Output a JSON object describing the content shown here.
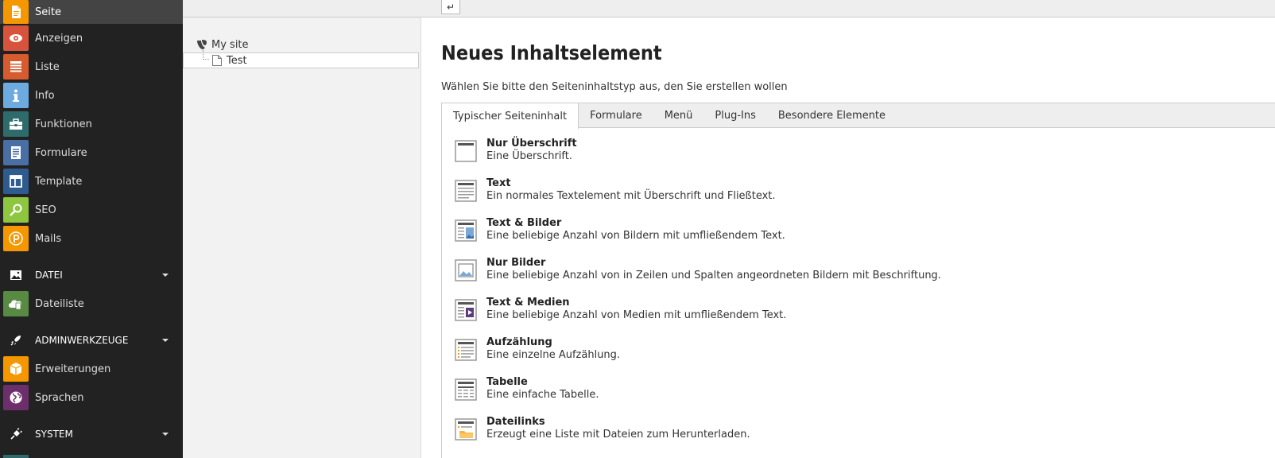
{
  "modules": [
    {
      "label": "Seite",
      "icon": "page-icon",
      "color": "#f49700",
      "active": true
    },
    {
      "label": "Anzeigen",
      "icon": "eye-icon",
      "color": "#d8533b"
    },
    {
      "label": "Liste",
      "icon": "list-icon",
      "color": "#d65b2f"
    },
    {
      "label": "Info",
      "icon": "info-icon",
      "color": "#6daae0"
    },
    {
      "label": "Funktionen",
      "icon": "toolbox-icon",
      "color": "#2e6c6c"
    },
    {
      "label": "Formulare",
      "icon": "form-icon",
      "color": "#4a6fa5"
    },
    {
      "label": "Template",
      "icon": "template-icon",
      "color": "#2f5c8e"
    },
    {
      "label": "SEO",
      "icon": "magnifier-icon",
      "color": "#8ec63f"
    },
    {
      "label": "Mails",
      "icon": "mail-p-icon",
      "color": "#f49700"
    }
  ],
  "groups": [
    {
      "label": "DATEI",
      "icon": "image-icon",
      "items": [
        {
          "label": "Dateiliste",
          "icon": "cloud-file-icon",
          "color": "#588a44"
        }
      ]
    },
    {
      "label": "ADMINWERKZEUGE",
      "icon": "rocket-icon",
      "items": [
        {
          "label": "Erweiterungen",
          "icon": "box-icon",
          "color": "#f49700"
        },
        {
          "label": "Sprachen",
          "icon": "globe-icon",
          "color": "#6c2f6c"
        }
      ]
    },
    {
      "label": "SYSTEM",
      "icon": "plug-icon",
      "items": []
    }
  ],
  "tree": {
    "root": "My site",
    "child": "Test"
  },
  "header": {
    "back_symbol": "↵"
  },
  "content": {
    "title": "Neues Inhaltselement",
    "description": "Wählen Sie bitte den Seiteninhaltstyp aus, den Sie erstellen wollen",
    "tabs": [
      "Typischer Seiteninhalt",
      "Formulare",
      "Menü",
      "Plug-Ins",
      "Besondere Elemente"
    ],
    "elements": [
      {
        "title": "Nur Überschrift",
        "desc": "Eine Überschrift.",
        "icon": "header-only-icon"
      },
      {
        "title": "Text",
        "desc": "Ein normales Textelement mit Überschrift und Fließtext.",
        "icon": "text-icon"
      },
      {
        "title": "Text & Bilder",
        "desc": "Eine beliebige Anzahl von Bildern mit umfließendem Text.",
        "icon": "text-images-icon"
      },
      {
        "title": "Nur Bilder",
        "desc": "Eine beliebige Anzahl von in Zeilen und Spalten angeordneten Bildern mit Beschriftung.",
        "icon": "images-only-icon"
      },
      {
        "title": "Text & Medien",
        "desc": "Eine beliebige Anzahl von Medien mit umfließendem Text.",
        "icon": "text-media-icon"
      },
      {
        "title": "Aufzählung",
        "desc": "Eine einzelne Aufzählung.",
        "icon": "bullets-icon"
      },
      {
        "title": "Tabelle",
        "desc": "Eine einfache Tabelle.",
        "icon": "table-icon"
      },
      {
        "title": "Dateilinks",
        "desc": "Erzeugt eine Liste mit Dateien zum Herunterladen.",
        "icon": "file-links-icon"
      }
    ]
  }
}
